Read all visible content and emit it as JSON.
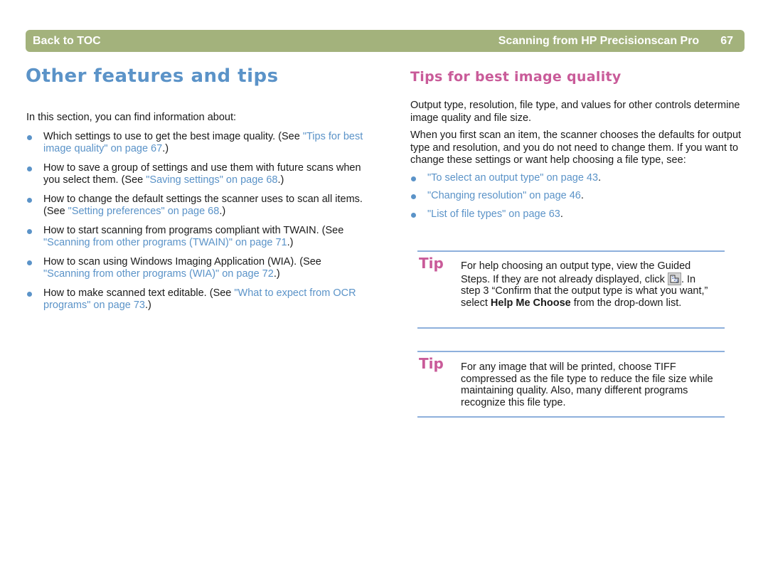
{
  "header": {
    "back_to_toc": "Back to TOC",
    "chapter_title": "Scanning from HP Precisionscan Pro",
    "page_number": "67",
    "bar_color": "#a3b27c"
  },
  "left": {
    "title": "Other features and tips",
    "intro": "In this section, you can find information about:",
    "items": [
      {
        "text": "Which settings to use to get the best image quality. (See ",
        "link": "\"Tips for best image quality\" on page 67",
        "tail": ".)"
      },
      {
        "text": "How to save a group of settings and use them with future scans when you select them. (See ",
        "link": "\"Saving settings\" on page 68",
        "tail": ".)"
      },
      {
        "text": "How to change the default settings the scanner uses to scan all items. (See ",
        "link": "\"Setting preferences\" on page 68",
        "tail": ".)"
      },
      {
        "text": "How to start scanning from programs compliant with TWAIN. (See ",
        "link": "\"Scanning from other programs (TWAIN)\" on page 71",
        "tail": ".)"
      },
      {
        "text": "How to scan using Windows Imaging Application (WIA). (See ",
        "link": "\"Scanning from other programs (WIA)\" on page 72",
        "tail": ".)"
      },
      {
        "text": "How to make scanned text editable. (See ",
        "link": "\"What to expect from OCR programs\" on page 73",
        "tail": ".)"
      }
    ]
  },
  "right": {
    "title": "Tips for best image quality",
    "para1": "Output type, resolution, file type, and values for other controls determine image quality and file size.",
    "para2": "When you first scan an item, the scanner chooses the defaults for output type and resolution, and you do not need to change them. If you want to change these settings or want help choosing a file type, see:",
    "links": [
      {
        "link": "\"To select an output type\" on page 43",
        "tail": "."
      },
      {
        "link": "\"Changing resolution\" on page 46",
        "tail": "."
      },
      {
        "link": "\"List of file types\" on page 63",
        "tail": "."
      }
    ]
  },
  "tips": [
    {
      "label": "Tip",
      "part1": "For help choosing an output type, view the Guided Steps. If they are not already displayed, click ",
      "icon": "guided-steps-icon",
      "part2": ". In step 3 “Confirm that the output type is what you want,” select ",
      "bold": "Help Me Choose",
      "part3": " from the drop-down list."
    },
    {
      "label": "Tip",
      "text": "For any image that will be printed, choose TIFF compressed as the file type to reduce the file size while maintaining quality. Also, many different programs recognize this file type."
    }
  ],
  "colors": {
    "link": "#5b93c8",
    "heading_blue": "#5b93c8",
    "heading_pink": "#c95b99",
    "rule": "#8eb0dc"
  }
}
